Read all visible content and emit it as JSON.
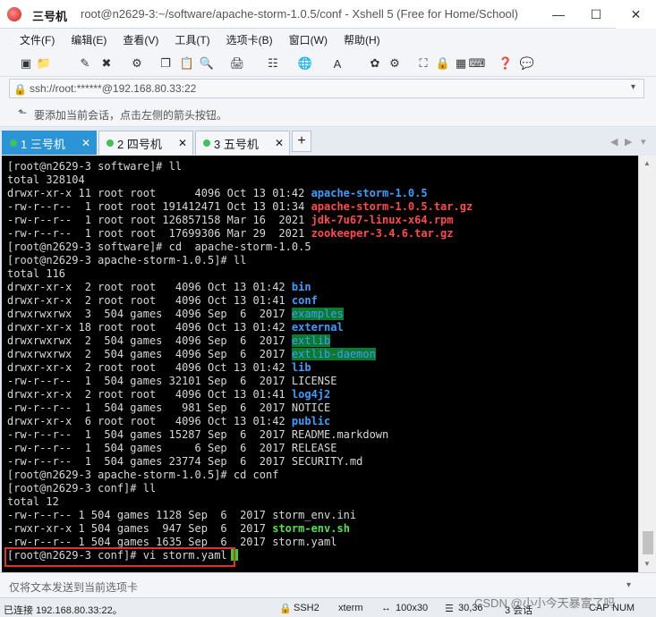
{
  "titlebar": {
    "session_name": "三号机",
    "window_title": "root@n2629-3:~/software/apache-storm-1.0.5/conf - Xshell 5 (Free for Home/School)",
    "min": "—",
    "max": "☐",
    "close": "✕"
  },
  "menu": [
    "文件(F)",
    "编辑(E)",
    "查看(V)",
    "工具(T)",
    "选项卡(B)",
    "窗口(W)",
    "帮助(H)"
  ],
  "address": {
    "text": "ssh://root:******@192.168.80.33:22",
    "dropdown": "▾"
  },
  "hint": {
    "text": "要添加当前会话，点击左侧的箭头按钮。"
  },
  "tabs": [
    {
      "label": "1 三号机",
      "dot": "#3fc25a",
      "close": "✕"
    },
    {
      "label": "2 四号机",
      "dot": "#3fc25a",
      "close": "✕"
    },
    {
      "label": "3 五号机",
      "dot": "#3fc25a",
      "close": "✕"
    }
  ],
  "tab_add": "+",
  "terminal": {
    "lines": [
      [
        {
          "t": "[root@n2629-3 software]# ll"
        }
      ],
      [
        {
          "t": "total 328104"
        }
      ],
      [
        {
          "t": "drwxr-xr-x 11 root root      4096 Oct 13 01:42 "
        },
        {
          "t": "apache-storm-1.0.5",
          "c": "blue"
        }
      ],
      [
        {
          "t": "-rw-r--r--  1 root root 191412471 Oct 13 01:34 "
        },
        {
          "t": "apache-storm-1.0.5.tar.gz",
          "c": "red"
        }
      ],
      [
        {
          "t": "-rw-r--r--  1 root root 126857158 Mar 16  2021 "
        },
        {
          "t": "jdk-7u67-linux-x64.rpm",
          "c": "red"
        }
      ],
      [
        {
          "t": "-rw-r--r--  1 root root  17699306 Mar 29  2021 "
        },
        {
          "t": "zookeeper-3.4.6.tar.gz",
          "c": "red"
        }
      ],
      [
        {
          "t": "[root@n2629-3 software]# cd  apache-storm-1.0.5"
        }
      ],
      [
        {
          "t": "[root@n2629-3 apache-storm-1.0.5]# ll"
        }
      ],
      [
        {
          "t": "total 116"
        }
      ],
      [
        {
          "t": "drwxr-xr-x  2 root root   4096 Oct 13 01:42 "
        },
        {
          "t": "bin",
          "c": "blue"
        }
      ],
      [
        {
          "t": "drwxr-xr-x  2 root root   4096 Oct 13 01:41 "
        },
        {
          "t": "conf",
          "c": "blue"
        }
      ],
      [
        {
          "t": "drwxrwxrwx  3  504 games  4096 Sep  6  2017 "
        },
        {
          "t": "examples",
          "c": "hl"
        }
      ],
      [
        {
          "t": "drwxr-xr-x 18 root root   4096 Oct 13 01:42 "
        },
        {
          "t": "external",
          "c": "blue"
        }
      ],
      [
        {
          "t": "drwxrwxrwx  2  504 games  4096 Sep  6  2017 "
        },
        {
          "t": "extlib",
          "c": "hl"
        }
      ],
      [
        {
          "t": "drwxrwxrwx  2  504 games  4096 Sep  6  2017 "
        },
        {
          "t": "extlib-daemon",
          "c": "hl"
        }
      ],
      [
        {
          "t": "drwxr-xr-x  2 root root   4096 Oct 13 01:42 "
        },
        {
          "t": "lib",
          "c": "blue"
        }
      ],
      [
        {
          "t": "-rw-r--r--  1  504 games 32101 Sep  6  2017 LICENSE"
        }
      ],
      [
        {
          "t": "drwxr-xr-x  2 root root   4096 Oct 13 01:41 "
        },
        {
          "t": "log4j2",
          "c": "blue"
        }
      ],
      [
        {
          "t": "-rw-r--r--  1  504 games   981 Sep  6  2017 NOTICE"
        }
      ],
      [
        {
          "t": "drwxr-xr-x  6 root root   4096 Oct 13 01:42 "
        },
        {
          "t": "public",
          "c": "blue"
        }
      ],
      [
        {
          "t": "-rw-r--r--  1  504 games 15287 Sep  6  2017 README.markdown"
        }
      ],
      [
        {
          "t": "-rw-r--r--  1  504 games     6 Sep  6  2017 RELEASE"
        }
      ],
      [
        {
          "t": "-rw-r--r--  1  504 games 23774 Sep  6  2017 SECURITY.md"
        }
      ],
      [
        {
          "t": "[root@n2629-3 apache-storm-1.0.5]# cd conf"
        }
      ],
      [
        {
          "t": "[root@n2629-3 conf]# ll"
        }
      ],
      [
        {
          "t": "total 12"
        }
      ],
      [
        {
          "t": "-rw-r--r-- 1 504 games 1128 Sep  6  2017 storm_env.ini"
        }
      ],
      [
        {
          "t": "-rwxr-xr-x 1 504 games  947 Sep  6  2017 "
        },
        {
          "t": "storm-env.sh",
          "c": "green"
        }
      ],
      [
        {
          "t": "-rw-r--r-- 1 504 games 1635 Sep  6  2017 storm.yaml"
        }
      ],
      [
        {
          "t": "[root@n2629-3 conf]# vi storm.yaml"
        },
        {
          "t": "",
          "c": "cursor"
        }
      ]
    ]
  },
  "sendbar": {
    "text": "仅将文本发送到当前选项卡",
    "dropdown": "▾"
  },
  "status": {
    "connection": "已连接 192.168.80.33:22。",
    "protocol": "SSH2",
    "term": "xterm",
    "size": "100x30",
    "pos": "30,36",
    "sessions": "3 会话",
    "caps": "CAP",
    "num": "NUM"
  },
  "watermark": "CSDN @小小今天暴富了吗"
}
